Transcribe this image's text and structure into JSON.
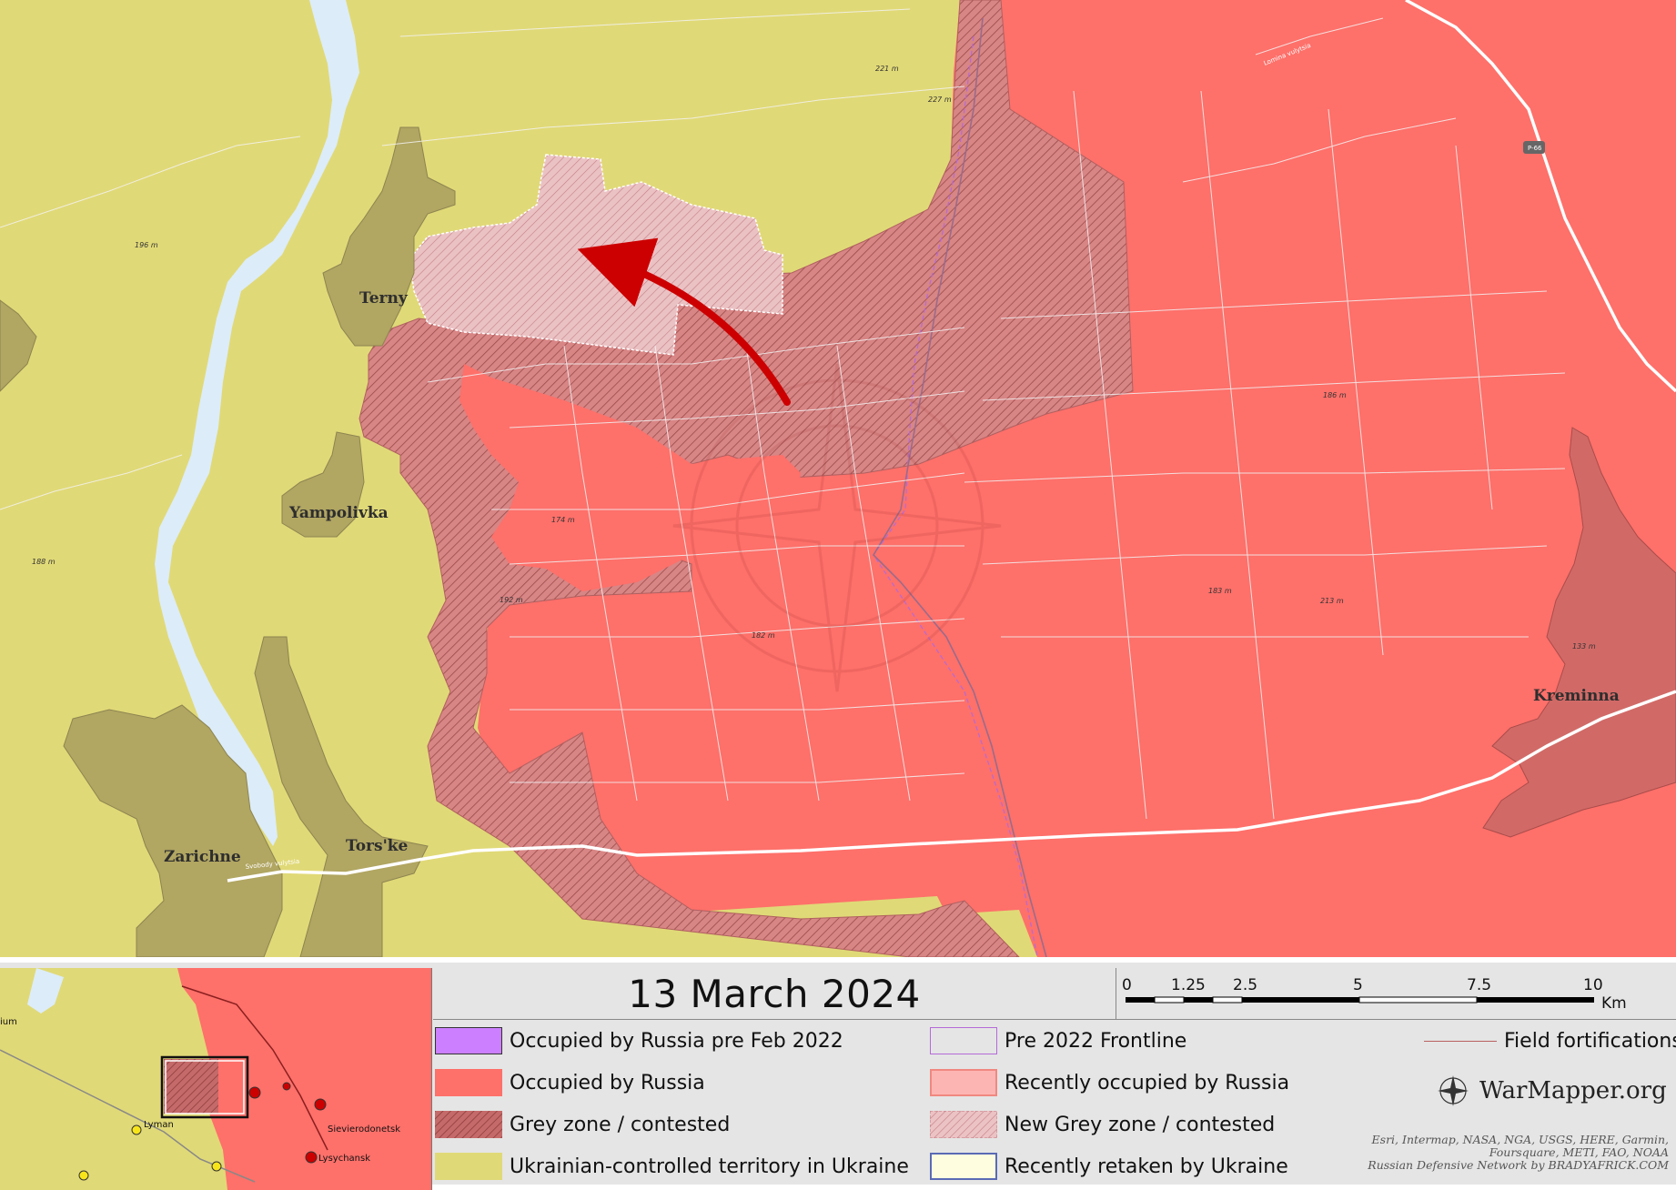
{
  "map": {
    "title": "13 March 2024",
    "places": [
      {
        "name": "Terny"
      },
      {
        "name": "Yampolivka"
      },
      {
        "name": "Zarichne"
      },
      {
        "name": "Tors'ke"
      },
      {
        "name": "Kreminna"
      }
    ],
    "elevation_labels": [
      "221 m",
      "227 m",
      "196 m",
      "188 m",
      "174 m",
      "192 m",
      "182 m",
      "186 m",
      "183 m",
      "213 m",
      "133 m"
    ],
    "road_labels": {
      "p66": "P-66",
      "lomina": "Lomina vulytsia",
      "svobody": "Svobody vulytsia"
    },
    "colors": {
      "ukraine": "#e0d977",
      "russia": "#fe706a",
      "grey_zone": "#d88585",
      "new_grey_zone": "#e8b3b6",
      "pre2022": "#cc80ff",
      "river": "#dcecf8",
      "settlement_ua": "#b1a662",
      "settlement_ru": "#d16a67",
      "arrow": "#cc0000"
    }
  },
  "legend": {
    "items": [
      {
        "key": "pre2022_occupied",
        "label": "Occupied by Russia pre Feb 2022",
        "color": "#cc80ff"
      },
      {
        "key": "pre2022_frontline",
        "label": "Pre 2022 Frontline",
        "color": "#b56ad8"
      },
      {
        "key": "field_fortifications",
        "label": "Field fortifications",
        "color": "#b96060"
      },
      {
        "key": "occupied",
        "label": "Occupied by Russia",
        "color": "#fe706a"
      },
      {
        "key": "recently_occupied",
        "label": "Recently occupied by Russia",
        "color": "#fdb5b3"
      },
      {
        "key": "grey_zone",
        "label": "Grey zone / contested",
        "color": "#c56a6a"
      },
      {
        "key": "new_grey_zone",
        "label": "New Grey zone / contested",
        "color": "#e6b1b4"
      },
      {
        "key": "ukraine",
        "label": "Ukrainian-controlled territory in Ukraine",
        "color": "#e0d977"
      },
      {
        "key": "retaken",
        "label": "Recently retaken by Ukraine",
        "color": "#fffddf"
      }
    ]
  },
  "scalebar": {
    "ticks": [
      "0",
      "1.25",
      "2.5",
      "5",
      "7.5",
      "10"
    ],
    "unit": "Km"
  },
  "inset": {
    "labels": [
      "Lyman",
      "Sievierodonetsk",
      "Lysychansk",
      "ium"
    ]
  },
  "brand": {
    "logo": "WarMapper.org",
    "attribution": [
      "Esri, Intermap, NASA, NGA, USGS, HERE, Garmin,",
      "Foursquare, METI, FAO, NOAA",
      "Russian Defensive Network by BRADYAFRICK.COM"
    ]
  }
}
